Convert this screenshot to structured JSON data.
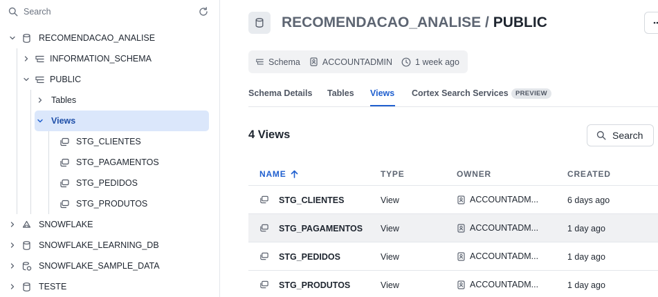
{
  "sidebar": {
    "search_placeholder": "Search",
    "tree": [
      {
        "label": "RECOMENDACAO_ANALISE",
        "icon": "database-icon",
        "expanded": true
      },
      {
        "label": "INFORMATION_SCHEMA",
        "icon": "schema-icon",
        "expanded": false
      },
      {
        "label": "PUBLIC",
        "icon": "schema-icon",
        "expanded": true
      },
      {
        "label": "Tables",
        "icon": "",
        "expanded": false
      },
      {
        "label": "Views",
        "icon": "",
        "expanded": true
      },
      {
        "label": "STG_CLIENTES",
        "icon": "view-icon"
      },
      {
        "label": "STG_PAGAMENTOS",
        "icon": "view-icon"
      },
      {
        "label": "STG_PEDIDOS",
        "icon": "view-icon"
      },
      {
        "label": "STG_PRODUTOS",
        "icon": "view-icon"
      },
      {
        "label": "SNOWFLAKE",
        "icon": "snowflake-db-icon",
        "expanded": false
      },
      {
        "label": "SNOWFLAKE_LEARNING_DB",
        "icon": "database-icon",
        "expanded": false
      },
      {
        "label": "SNOWFLAKE_SAMPLE_DATA",
        "icon": "shared-database-icon",
        "expanded": false
      },
      {
        "label": "TESTE",
        "icon": "database-icon",
        "expanded": false
      }
    ]
  },
  "header": {
    "database": "RECOMENDACAO_ANALISE",
    "separator": " / ",
    "schema": "PUBLIC"
  },
  "meta": {
    "type": "Schema",
    "owner": "ACCOUNTADMIN",
    "age": "1 week ago"
  },
  "tabs": [
    {
      "label": "Schema Details",
      "active": false
    },
    {
      "label": "Tables",
      "active": false
    },
    {
      "label": "Views",
      "active": true
    },
    {
      "label": "Cortex Search Services",
      "active": false,
      "badge": "PREVIEW"
    }
  ],
  "views": {
    "count_label": "4 Views",
    "search_label": "Search",
    "columns": [
      "NAME",
      "TYPE",
      "OWNER",
      "CREATED"
    ],
    "rows": [
      {
        "name": "STG_CLIENTES",
        "type": "View",
        "owner": "ACCOUNTADM...",
        "created": "6 days ago"
      },
      {
        "name": "STG_PAGAMENTOS",
        "type": "View",
        "owner": "ACCOUNTADM...",
        "created": "1 day ago"
      },
      {
        "name": "STG_PEDIDOS",
        "type": "View",
        "owner": "ACCOUNTADM...",
        "created": "1 day ago"
      },
      {
        "name": "STG_PRODUTOS",
        "type": "View",
        "owner": "ACCOUNTADM...",
        "created": "1 day ago"
      }
    ]
  },
  "colors": {
    "accent": "#1f5fcf",
    "active_row": "#dbe7fb",
    "hover_row": "#f0f1f3"
  }
}
